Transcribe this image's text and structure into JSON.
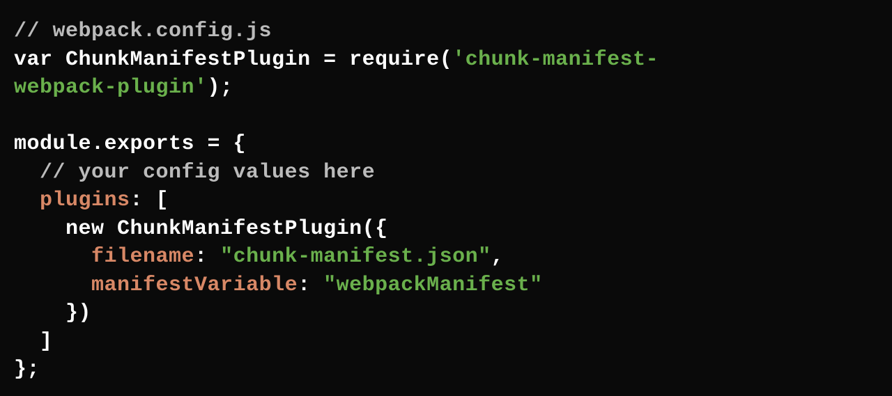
{
  "code": {
    "line1_comment": "// webpack.config.js",
    "line2_var": "var ChunkManifestPlugin = require(",
    "line2_string": "'chunk-manifest-",
    "line3_string": "webpack-plugin'",
    "line3_end": ");",
    "line5": "module.exports = {",
    "line6_comment": "  // your config values here",
    "line7_indent": "  ",
    "line7_prop": "plugins",
    "line7_end": ": [",
    "line8": "    new ChunkManifestPlugin({",
    "line9_indent": "      ",
    "line9_prop": "filename",
    "line9_colon": ": ",
    "line9_string": "\"chunk-manifest.json\"",
    "line9_end": ",",
    "line10_indent": "      ",
    "line10_prop": "manifestVariable",
    "line10_colon": ": ",
    "line10_string": "\"webpackManifest\"",
    "line11": "    })",
    "line12": "  ]",
    "line13": "};"
  }
}
